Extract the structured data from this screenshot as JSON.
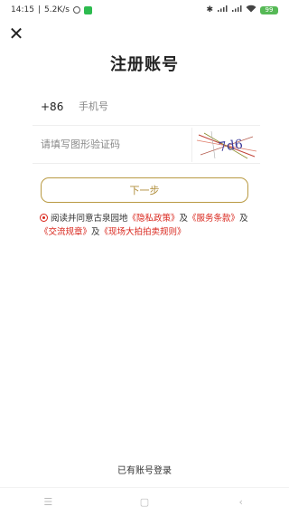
{
  "status_bar": {
    "time": "14:15",
    "speed": "5.2K/s",
    "battery": "99"
  },
  "title": "注册账号",
  "phone": {
    "country_code": "+86",
    "placeholder": "手机号"
  },
  "captcha": {
    "placeholder": "请填写图形验证码",
    "image_text": "7d6"
  },
  "next_label": "下一步",
  "agreement": {
    "prefix": "阅读并同意古泉园地",
    "privacy": "《隐私政策》",
    "and1": "及",
    "service": "《服务条款》",
    "and2": "及",
    "trade": "《交流规章》",
    "and3": "及",
    "auction": "《现场大拍拍卖规则》"
  },
  "login_link": "已有账号登录",
  "colors": {
    "accent_gold": "#b99a43",
    "link_red": "#d9261c"
  }
}
